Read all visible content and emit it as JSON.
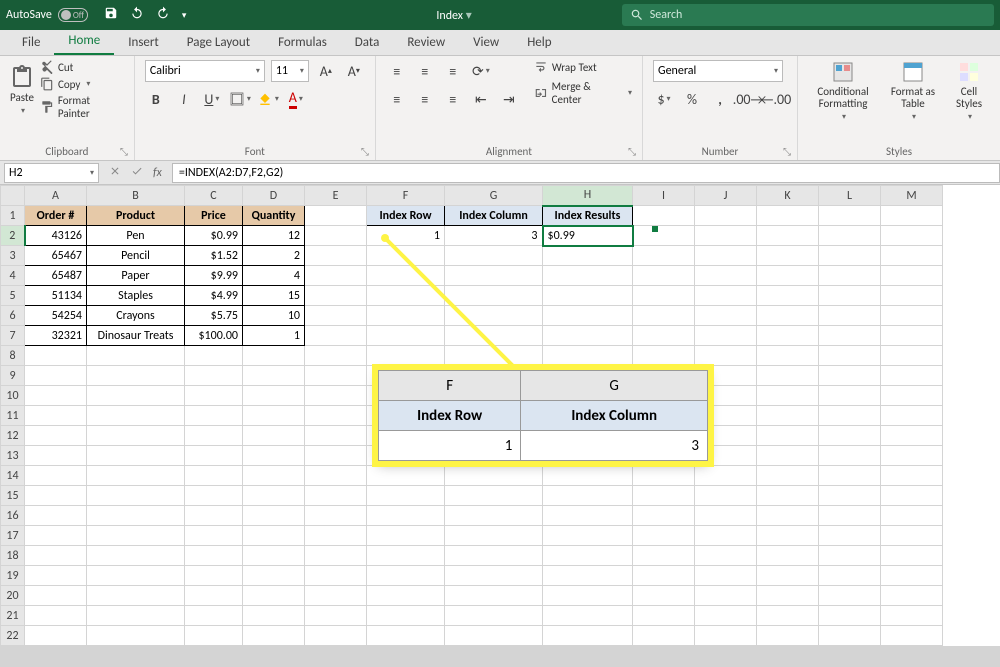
{
  "title_bar": {
    "autosave": "AutoSave",
    "autosave_state": "Off",
    "doc_name": "Index",
    "search_placeholder": "Search"
  },
  "tabs": {
    "file": "File",
    "home": "Home",
    "insert": "Insert",
    "page_layout": "Page Layout",
    "formulas": "Formulas",
    "data": "Data",
    "review": "Review",
    "view": "View",
    "help": "Help"
  },
  "ribbon": {
    "clipboard": {
      "paste": "Paste",
      "cut": "Cut",
      "copy": "Copy",
      "fmt_painter": "Format Painter",
      "label": "Clipboard"
    },
    "font": {
      "name": "Calibri",
      "size": "11",
      "label": "Font"
    },
    "alignment": {
      "wrap": "Wrap Text",
      "merge": "Merge & Center",
      "label": "Alignment"
    },
    "number": {
      "format": "General",
      "label": "Number"
    },
    "styles": {
      "cond": "Conditional Formatting",
      "table": "Format as Table",
      "cell": "Cell Styles",
      "label": "Styles"
    }
  },
  "formula_bar": {
    "name_box": "H2",
    "formula": "=INDEX(A2:D7,F2,G2)"
  },
  "columns": [
    "A",
    "B",
    "C",
    "D",
    "E",
    "F",
    "G",
    "H",
    "I",
    "J",
    "K",
    "L",
    "M"
  ],
  "headers": {
    "A": "Order #",
    "B": "Product",
    "C": "Price",
    "D": "Quantity",
    "F": "Index Row",
    "G": "Index Column",
    "H": "Index Results"
  },
  "rows": [
    {
      "order": "43126",
      "product": "Pen",
      "price": "$0.99",
      "qty": "12"
    },
    {
      "order": "65467",
      "product": "Pencil",
      "price": "$1.52",
      "qty": "2"
    },
    {
      "order": "65487",
      "product": "Paper",
      "price": "$9.99",
      "qty": "4"
    },
    {
      "order": "51134",
      "product": "Staples",
      "price": "$4.99",
      "qty": "15"
    },
    {
      "order": "54254",
      "product": "Crayons",
      "price": "$5.75",
      "qty": "10"
    },
    {
      "order": "32321",
      "product": "Dinosaur Treats",
      "price": "$100.00",
      "qty": "1"
    }
  ],
  "index_inputs": {
    "row": "1",
    "col": "3",
    "result": "$0.99"
  },
  "callout": {
    "col_f": "F",
    "col_g": "G",
    "hdr_row": "Index Row",
    "hdr_col": "Index Column",
    "val_row": "1",
    "val_col": "3"
  }
}
